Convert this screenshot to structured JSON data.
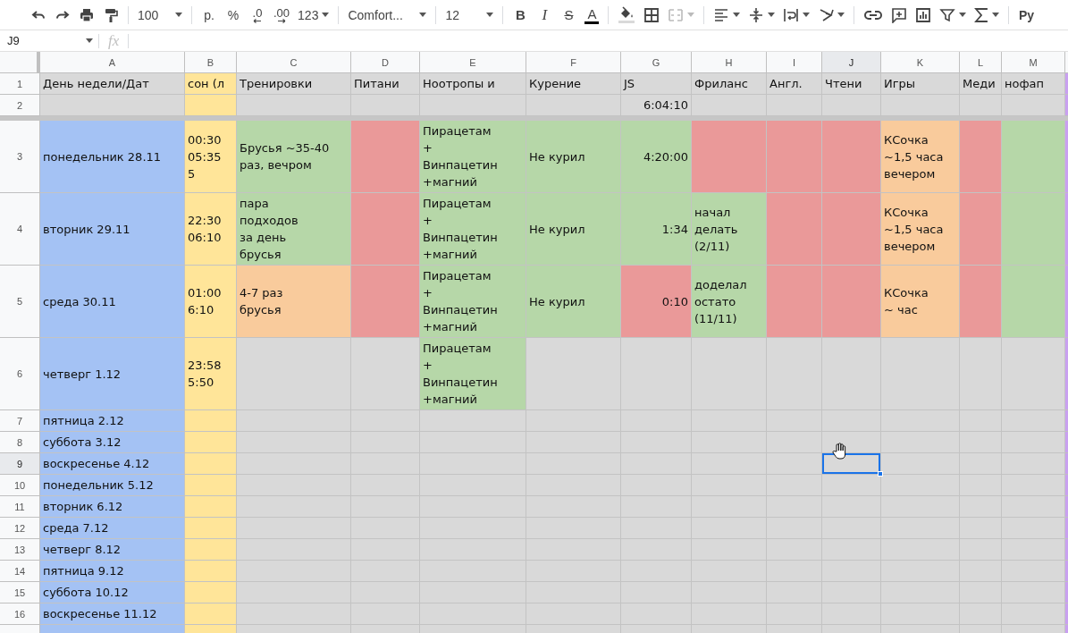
{
  "toolbar": {
    "zoom": "100",
    "currency": "р.",
    "percent": "%",
    "decrease_decimals": ".0",
    "increase_decimals": ".00",
    "more_formats": "123",
    "font": "Comfort...",
    "font_size": "12",
    "bold": "B",
    "italic": "I",
    "strikethrough": "S",
    "text_color": "A",
    "input_tools": "Py"
  },
  "formula_bar": {
    "name_box": "J9",
    "fx": "fx"
  },
  "columns": [
    {
      "label": "A",
      "selected": false
    },
    {
      "label": "B",
      "selected": false
    },
    {
      "label": "C",
      "selected": false
    },
    {
      "label": "D",
      "selected": false
    },
    {
      "label": "E",
      "selected": false
    },
    {
      "label": "F",
      "selected": false
    },
    {
      "label": "G",
      "selected": false
    },
    {
      "label": "H",
      "selected": false
    },
    {
      "label": "I",
      "selected": false
    },
    {
      "label": "J",
      "selected": true
    },
    {
      "label": "K",
      "selected": false
    },
    {
      "label": "L",
      "selected": false
    },
    {
      "label": "M",
      "selected": false
    }
  ],
  "frozen_rows": [
    {
      "number": "1",
      "selected": false,
      "cells": [
        {
          "kind": "text",
          "text": "День недели/Дат",
          "color": "#d9d9d9"
        },
        {
          "kind": "text",
          "text": "сон (л",
          "color": "#ffe599"
        },
        {
          "kind": "text",
          "text": "Тренировки",
          "color": "#d9d9d9"
        },
        {
          "kind": "text",
          "text": "Питани",
          "color": "#d9d9d9"
        },
        {
          "kind": "text",
          "text": "Ноотропы и",
          "color": "#d9d9d9"
        },
        {
          "kind": "text",
          "text": "Курение",
          "color": "#d9d9d9"
        },
        {
          "kind": "text",
          "text": "JS",
          "color": "#d9d9d9"
        },
        {
          "kind": "text",
          "text": "Фриланс",
          "color": "#d9d9d9"
        },
        {
          "kind": "text",
          "text": "Англ.",
          "color": "#d9d9d9"
        },
        {
          "kind": "text",
          "text": "Чтени",
          "color": "#d9d9d9"
        },
        {
          "kind": "text",
          "text": "Игры",
          "color": "#d9d9d9"
        },
        {
          "kind": "text",
          "text": "Меди",
          "color": "#d9d9d9"
        },
        {
          "kind": "text",
          "text": "нофап",
          "color": "#d9d9d9"
        }
      ]
    },
    {
      "number": "2",
      "selected": false,
      "cells": [
        {
          "kind": "text",
          "color": "#d9d9d9"
        },
        {
          "kind": "text",
          "color": "#ffe599"
        },
        {
          "kind": "text",
          "color": "#d9d9d9"
        },
        {
          "kind": "text",
          "color": "#d9d9d9"
        },
        {
          "kind": "text",
          "color": "#d9d9d9"
        },
        {
          "kind": "text",
          "color": "#d9d9d9"
        },
        {
          "kind": "number",
          "text": "6:04:10",
          "color": "#d9d9d9"
        },
        {
          "kind": "text",
          "color": "#d9d9d9"
        },
        {
          "kind": "text",
          "color": "#d9d9d9"
        },
        {
          "kind": "text",
          "color": "#d9d9d9"
        },
        {
          "kind": "text",
          "color": "#d9d9d9"
        },
        {
          "kind": "text",
          "color": "#d9d9d9"
        },
        {
          "kind": "text",
          "color": "#d9d9d9"
        }
      ]
    }
  ],
  "rows": [
    {
      "number": "3",
      "selected": false,
      "cells": [
        {
          "kind": "text",
          "text": "понедельник 28.11",
          "color": "#a4c2f4"
        },
        {
          "kind": "text",
          "text": "00:30\n05:35\n5",
          "color": "#ffe599"
        },
        {
          "kind": "text",
          "text": "Брусья ~35-40\nраз, вечром",
          "color": "#b6d7a8"
        },
        {
          "kind": "text",
          "color": "#ea9999"
        },
        {
          "kind": "text",
          "text": "Пирацетам\n+\nВинпацетин\n+магний",
          "color": "#b6d7a8"
        },
        {
          "kind": "text",
          "text": "Не курил",
          "color": "#b6d7a8"
        },
        {
          "kind": "number",
          "text": "4:20:00",
          "color": "#b6d7a8"
        },
        {
          "kind": "text",
          "color": "#ea9999"
        },
        {
          "kind": "text",
          "color": "#ea9999"
        },
        {
          "kind": "text",
          "color": "#ea9999"
        },
        {
          "kind": "text",
          "text": "КСочка\n~1,5 часа\nвечером",
          "color": "#f9cb9c"
        },
        {
          "kind": "text",
          "color": "#ea9999"
        },
        {
          "kind": "text",
          "color": "#b6d7a8"
        }
      ]
    },
    {
      "number": "4",
      "selected": false,
      "cells": [
        {
          "kind": "text",
          "text": "вторник 29.11",
          "color": "#a4c2f4"
        },
        {
          "kind": "text",
          "text": "22:30\n06:10",
          "color": "#ffe599"
        },
        {
          "kind": "text",
          "text": "пара\nподходов\nза день\nбрусья",
          "color": "#b6d7a8"
        },
        {
          "kind": "text",
          "color": "#ea9999"
        },
        {
          "kind": "text",
          "text": "Пирацетам\n+\nВинпацетин\n+магний",
          "color": "#b6d7a8"
        },
        {
          "kind": "text",
          "text": "Не курил",
          "color": "#b6d7a8"
        },
        {
          "kind": "number",
          "text": "1:34",
          "color": "#b6d7a8"
        },
        {
          "kind": "text",
          "text": "начал\nделать\n(2/11)",
          "color": "#b6d7a8"
        },
        {
          "kind": "text",
          "color": "#ea9999"
        },
        {
          "kind": "text",
          "color": "#ea9999"
        },
        {
          "kind": "text",
          "text": "КСочка\n~1,5 часа\nвечером",
          "color": "#f9cb9c"
        },
        {
          "kind": "text",
          "color": "#ea9999"
        },
        {
          "kind": "text",
          "color": "#b6d7a8"
        }
      ]
    },
    {
      "number": "5",
      "selected": false,
      "cells": [
        {
          "kind": "text",
          "text": "среда 30.11",
          "color": "#a4c2f4"
        },
        {
          "kind": "text",
          "text": "01:00\n6:10",
          "color": "#ffe599"
        },
        {
          "kind": "text",
          "text": "4-7 раз\nбрусья",
          "color": "#f9cb9c"
        },
        {
          "kind": "text",
          "color": "#ea9999"
        },
        {
          "kind": "text",
          "text": "Пирацетам\n+\nВинпацетин\n+магний",
          "color": "#b6d7a8"
        },
        {
          "kind": "text",
          "text": "Не курил",
          "color": "#b6d7a8"
        },
        {
          "kind": "number",
          "text": "0:10",
          "color": "#ea9999"
        },
        {
          "kind": "text",
          "text": "доделал\nостато\n(11/11)",
          "color": "#b6d7a8"
        },
        {
          "kind": "text",
          "color": "#ea9999"
        },
        {
          "kind": "text",
          "color": "#ea9999"
        },
        {
          "kind": "text",
          "text": "КСочка\n~ час",
          "color": "#f9cb9c"
        },
        {
          "kind": "text",
          "color": "#ea9999"
        },
        {
          "kind": "text",
          "color": "#b6d7a8"
        }
      ]
    },
    {
      "number": "6",
      "selected": false,
      "cells": [
        {
          "kind": "text",
          "text": "четверг 1.12",
          "color": "#a4c2f4"
        },
        {
          "kind": "text",
          "text": "23:58\n5:50",
          "color": "#ffe599"
        },
        {
          "kind": "text",
          "color": "#d9d9d9"
        },
        {
          "kind": "text",
          "color": "#d9d9d9"
        },
        {
          "kind": "text",
          "text": "Пирацетам\n+\nВинпацетин\n+магний",
          "color": "#b6d7a8"
        },
        {
          "kind": "text",
          "color": "#d9d9d9"
        },
        {
          "kind": "text",
          "color": "#d9d9d9"
        },
        {
          "kind": "text",
          "color": "#d9d9d9"
        },
        {
          "kind": "text",
          "color": "#d9d9d9"
        },
        {
          "kind": "text",
          "color": "#d9d9d9"
        },
        {
          "kind": "text",
          "color": "#d9d9d9"
        },
        {
          "kind": "text",
          "color": "#d9d9d9"
        },
        {
          "kind": "text",
          "color": "#d9d9d9"
        }
      ]
    },
    {
      "number": "7",
      "selected": false,
      "cells": [
        {
          "kind": "text",
          "text": "пятница 2.12",
          "color": "#a4c2f4"
        },
        {
          "kind": "text",
          "color": "#ffe599"
        },
        {
          "kind": "text",
          "color": "#d9d9d9"
        },
        {
          "kind": "text",
          "color": "#d9d9d9"
        },
        {
          "kind": "text",
          "color": "#d9d9d9"
        },
        {
          "kind": "text",
          "color": "#d9d9d9"
        },
        {
          "kind": "text",
          "color": "#d9d9d9"
        },
        {
          "kind": "text",
          "color": "#d9d9d9"
        },
        {
          "kind": "text",
          "color": "#d9d9d9"
        },
        {
          "kind": "text",
          "color": "#d9d9d9"
        },
        {
          "kind": "text",
          "color": "#d9d9d9"
        },
        {
          "kind": "text",
          "color": "#d9d9d9"
        },
        {
          "kind": "text",
          "color": "#d9d9d9"
        }
      ]
    },
    {
      "number": "8",
      "selected": false,
      "cells": [
        {
          "kind": "text",
          "text": "суббота 3.12",
          "color": "#a4c2f4"
        },
        {
          "kind": "text",
          "color": "#ffe599"
        },
        {
          "kind": "text",
          "color": "#d9d9d9"
        },
        {
          "kind": "text",
          "color": "#d9d9d9"
        },
        {
          "kind": "text",
          "color": "#d9d9d9"
        },
        {
          "kind": "text",
          "color": "#d9d9d9"
        },
        {
          "kind": "text",
          "color": "#d9d9d9"
        },
        {
          "kind": "text",
          "color": "#d9d9d9"
        },
        {
          "kind": "text",
          "color": "#d9d9d9"
        },
        {
          "kind": "text",
          "color": "#d9d9d9"
        },
        {
          "kind": "text",
          "color": "#d9d9d9"
        },
        {
          "kind": "text",
          "color": "#d9d9d9"
        },
        {
          "kind": "text",
          "color": "#d9d9d9"
        }
      ]
    },
    {
      "number": "9",
      "selected": true,
      "cells": [
        {
          "kind": "text",
          "text": "воскресенье 4.12",
          "color": "#a4c2f4"
        },
        {
          "kind": "text",
          "color": "#ffe599"
        },
        {
          "kind": "text",
          "color": "#d9d9d9"
        },
        {
          "kind": "text",
          "color": "#d9d9d9"
        },
        {
          "kind": "text",
          "color": "#d9d9d9"
        },
        {
          "kind": "text",
          "color": "#d9d9d9"
        },
        {
          "kind": "text",
          "color": "#d9d9d9"
        },
        {
          "kind": "text",
          "color": "#d9d9d9"
        },
        {
          "kind": "text",
          "color": "#d9d9d9"
        },
        {
          "kind": "text",
          "color": "#d9d9d9"
        },
        {
          "kind": "text",
          "color": "#d9d9d9"
        },
        {
          "kind": "text",
          "color": "#d9d9d9"
        },
        {
          "kind": "text",
          "color": "#d9d9d9"
        }
      ]
    },
    {
      "number": "10",
      "selected": false,
      "cells": [
        {
          "kind": "text",
          "text": "понедельник 5.12",
          "color": "#a4c2f4"
        },
        {
          "kind": "text",
          "color": "#ffe599"
        },
        {
          "kind": "text",
          "color": "#d9d9d9"
        },
        {
          "kind": "text",
          "color": "#d9d9d9"
        },
        {
          "kind": "text",
          "color": "#d9d9d9"
        },
        {
          "kind": "text",
          "color": "#d9d9d9"
        },
        {
          "kind": "text",
          "color": "#d9d9d9"
        },
        {
          "kind": "text",
          "color": "#d9d9d9"
        },
        {
          "kind": "text",
          "color": "#d9d9d9"
        },
        {
          "kind": "text",
          "color": "#d9d9d9"
        },
        {
          "kind": "text",
          "color": "#d9d9d9"
        },
        {
          "kind": "text",
          "color": "#d9d9d9"
        },
        {
          "kind": "text",
          "color": "#d9d9d9"
        }
      ]
    },
    {
      "number": "11",
      "selected": false,
      "cells": [
        {
          "kind": "text",
          "text": "вторник 6.12",
          "color": "#a4c2f4"
        },
        {
          "kind": "text",
          "color": "#ffe599"
        },
        {
          "kind": "text",
          "color": "#d9d9d9"
        },
        {
          "kind": "text",
          "color": "#d9d9d9"
        },
        {
          "kind": "text",
          "color": "#d9d9d9"
        },
        {
          "kind": "text",
          "color": "#d9d9d9"
        },
        {
          "kind": "text",
          "color": "#d9d9d9"
        },
        {
          "kind": "text",
          "color": "#d9d9d9"
        },
        {
          "kind": "text",
          "color": "#d9d9d9"
        },
        {
          "kind": "text",
          "color": "#d9d9d9"
        },
        {
          "kind": "text",
          "color": "#d9d9d9"
        },
        {
          "kind": "text",
          "color": "#d9d9d9"
        },
        {
          "kind": "text",
          "color": "#d9d9d9"
        }
      ]
    },
    {
      "number": "12",
      "selected": false,
      "cells": [
        {
          "kind": "text",
          "text": "среда 7.12",
          "color": "#a4c2f4"
        },
        {
          "kind": "text",
          "color": "#ffe599"
        },
        {
          "kind": "text",
          "color": "#d9d9d9"
        },
        {
          "kind": "text",
          "color": "#d9d9d9"
        },
        {
          "kind": "text",
          "color": "#d9d9d9"
        },
        {
          "kind": "text",
          "color": "#d9d9d9"
        },
        {
          "kind": "text",
          "color": "#d9d9d9"
        },
        {
          "kind": "text",
          "color": "#d9d9d9"
        },
        {
          "kind": "text",
          "color": "#d9d9d9"
        },
        {
          "kind": "text",
          "color": "#d9d9d9"
        },
        {
          "kind": "text",
          "color": "#d9d9d9"
        },
        {
          "kind": "text",
          "color": "#d9d9d9"
        },
        {
          "kind": "text",
          "color": "#d9d9d9"
        }
      ]
    },
    {
      "number": "13",
      "selected": false,
      "cells": [
        {
          "kind": "text",
          "text": "четверг 8.12",
          "color": "#a4c2f4"
        },
        {
          "kind": "text",
          "color": "#ffe599"
        },
        {
          "kind": "text",
          "color": "#d9d9d9"
        },
        {
          "kind": "text",
          "color": "#d9d9d9"
        },
        {
          "kind": "text",
          "color": "#d9d9d9"
        },
        {
          "kind": "text",
          "color": "#d9d9d9"
        },
        {
          "kind": "text",
          "color": "#d9d9d9"
        },
        {
          "kind": "text",
          "color": "#d9d9d9"
        },
        {
          "kind": "text",
          "color": "#d9d9d9"
        },
        {
          "kind": "text",
          "color": "#d9d9d9"
        },
        {
          "kind": "text",
          "color": "#d9d9d9"
        },
        {
          "kind": "text",
          "color": "#d9d9d9"
        },
        {
          "kind": "text",
          "color": "#d9d9d9"
        }
      ]
    },
    {
      "number": "14",
      "selected": false,
      "cells": [
        {
          "kind": "text",
          "text": "пятница 9.12",
          "color": "#a4c2f4"
        },
        {
          "kind": "text",
          "color": "#ffe599"
        },
        {
          "kind": "text",
          "color": "#d9d9d9"
        },
        {
          "kind": "text",
          "color": "#d9d9d9"
        },
        {
          "kind": "text",
          "color": "#d9d9d9"
        },
        {
          "kind": "text",
          "color": "#d9d9d9"
        },
        {
          "kind": "text",
          "color": "#d9d9d9"
        },
        {
          "kind": "text",
          "color": "#d9d9d9"
        },
        {
          "kind": "text",
          "color": "#d9d9d9"
        },
        {
          "kind": "text",
          "color": "#d9d9d9"
        },
        {
          "kind": "text",
          "color": "#d9d9d9"
        },
        {
          "kind": "text",
          "color": "#d9d9d9"
        },
        {
          "kind": "text",
          "color": "#d9d9d9"
        }
      ]
    },
    {
      "number": "15",
      "selected": false,
      "cells": [
        {
          "kind": "text",
          "text": "суббота 10.12",
          "color": "#a4c2f4"
        },
        {
          "kind": "text",
          "color": "#ffe599"
        },
        {
          "kind": "text",
          "color": "#d9d9d9"
        },
        {
          "kind": "text",
          "color": "#d9d9d9"
        },
        {
          "kind": "text",
          "color": "#d9d9d9"
        },
        {
          "kind": "text",
          "color": "#d9d9d9"
        },
        {
          "kind": "text",
          "color": "#d9d9d9"
        },
        {
          "kind": "text",
          "color": "#d9d9d9"
        },
        {
          "kind": "text",
          "color": "#d9d9d9"
        },
        {
          "kind": "text",
          "color": "#d9d9d9"
        },
        {
          "kind": "text",
          "color": "#d9d9d9"
        },
        {
          "kind": "text",
          "color": "#d9d9d9"
        },
        {
          "kind": "text",
          "color": "#d9d9d9"
        }
      ]
    },
    {
      "number": "16",
      "selected": false,
      "cells": [
        {
          "kind": "text",
          "text": "воскресенье 11.12",
          "color": "#a4c2f4"
        },
        {
          "kind": "text",
          "color": "#ffe599"
        },
        {
          "kind": "text",
          "color": "#d9d9d9"
        },
        {
          "kind": "text",
          "color": "#d9d9d9"
        },
        {
          "kind": "text",
          "color": "#d9d9d9"
        },
        {
          "kind": "text",
          "color": "#d9d9d9"
        },
        {
          "kind": "text",
          "color": "#d9d9d9"
        },
        {
          "kind": "text",
          "color": "#d9d9d9"
        },
        {
          "kind": "text",
          "color": "#d9d9d9"
        },
        {
          "kind": "text",
          "color": "#d9d9d9"
        },
        {
          "kind": "text",
          "color": "#d9d9d9"
        },
        {
          "kind": "text",
          "color": "#d9d9d9"
        },
        {
          "kind": "text",
          "color": "#d9d9d9"
        }
      ]
    },
    {
      "selected": false,
      "cells": [
        {
          "kind": "text",
          "color": "#a4c2f4"
        },
        {
          "kind": "text",
          "color": "#ffe599"
        },
        {
          "kind": "text",
          "color": "#d9d9d9"
        },
        {
          "kind": "text",
          "color": "#d9d9d9"
        },
        {
          "kind": "text",
          "color": "#d9d9d9"
        },
        {
          "kind": "text",
          "color": "#d9d9d9"
        },
        {
          "kind": "text",
          "color": "#d9d9d9"
        },
        {
          "kind": "text",
          "color": "#d9d9d9"
        },
        {
          "kind": "text",
          "color": "#d9d9d9"
        },
        {
          "kind": "text",
          "color": "#d9d9d9"
        },
        {
          "kind": "text",
          "color": "#d9d9d9"
        },
        {
          "kind": "text",
          "color": "#d9d9d9"
        },
        {
          "kind": "text",
          "color": "#d9d9d9"
        }
      ]
    }
  ]
}
